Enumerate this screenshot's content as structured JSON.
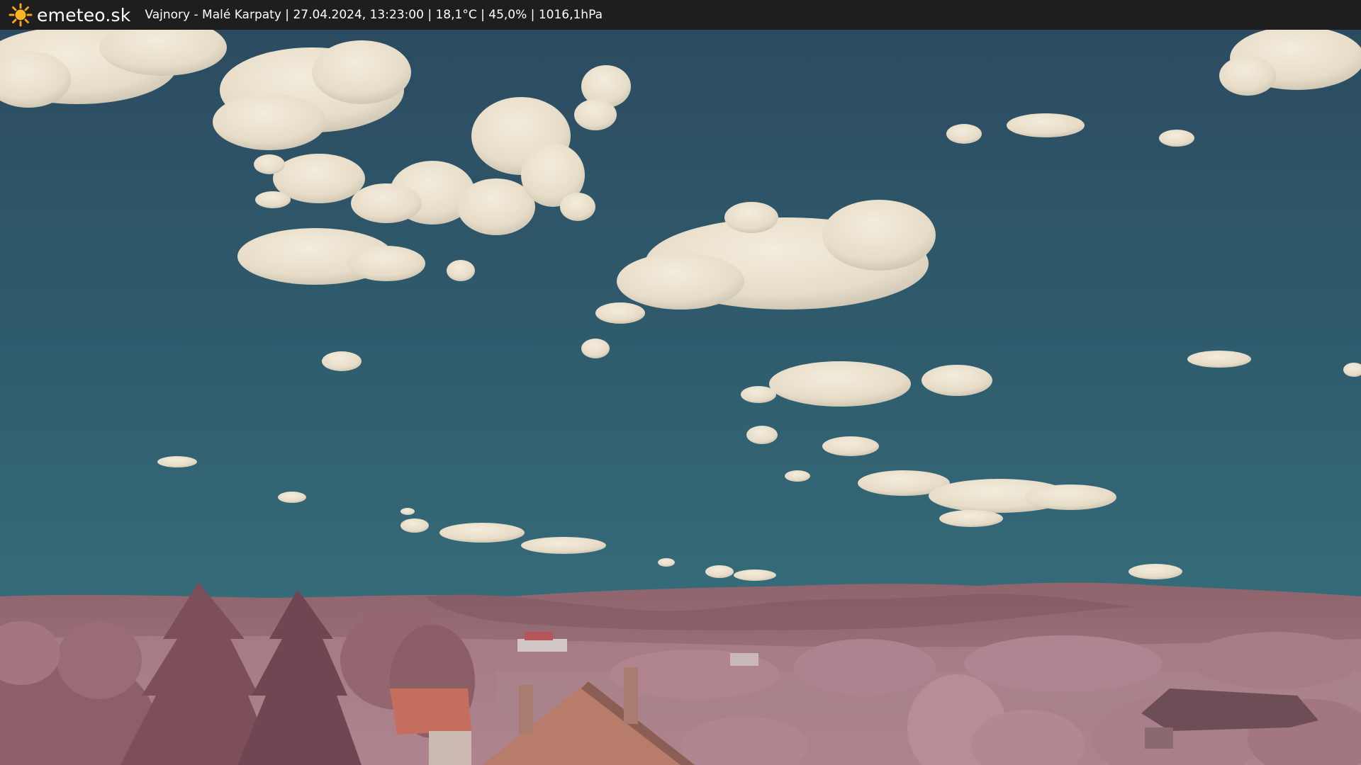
{
  "header": {
    "brand": "emeteo.sk",
    "brand_icon": "sun-icon",
    "location": "Vajnory - Malé Karpaty",
    "separator": " | ",
    "datetime": "27.04.2024, 13:23:00",
    "temperature": "18,1°C",
    "humidity": "45,0%",
    "pressure": "1016,1hPa"
  },
  "colors": {
    "bar_background": "#1e1e1e",
    "sky_top": "#2d4f63",
    "sky_bottom": "#34707c",
    "cloud": "#ece3d1",
    "hills": "#9a6c75",
    "vegetation": "#b07f88",
    "roof": "#c0735f"
  }
}
